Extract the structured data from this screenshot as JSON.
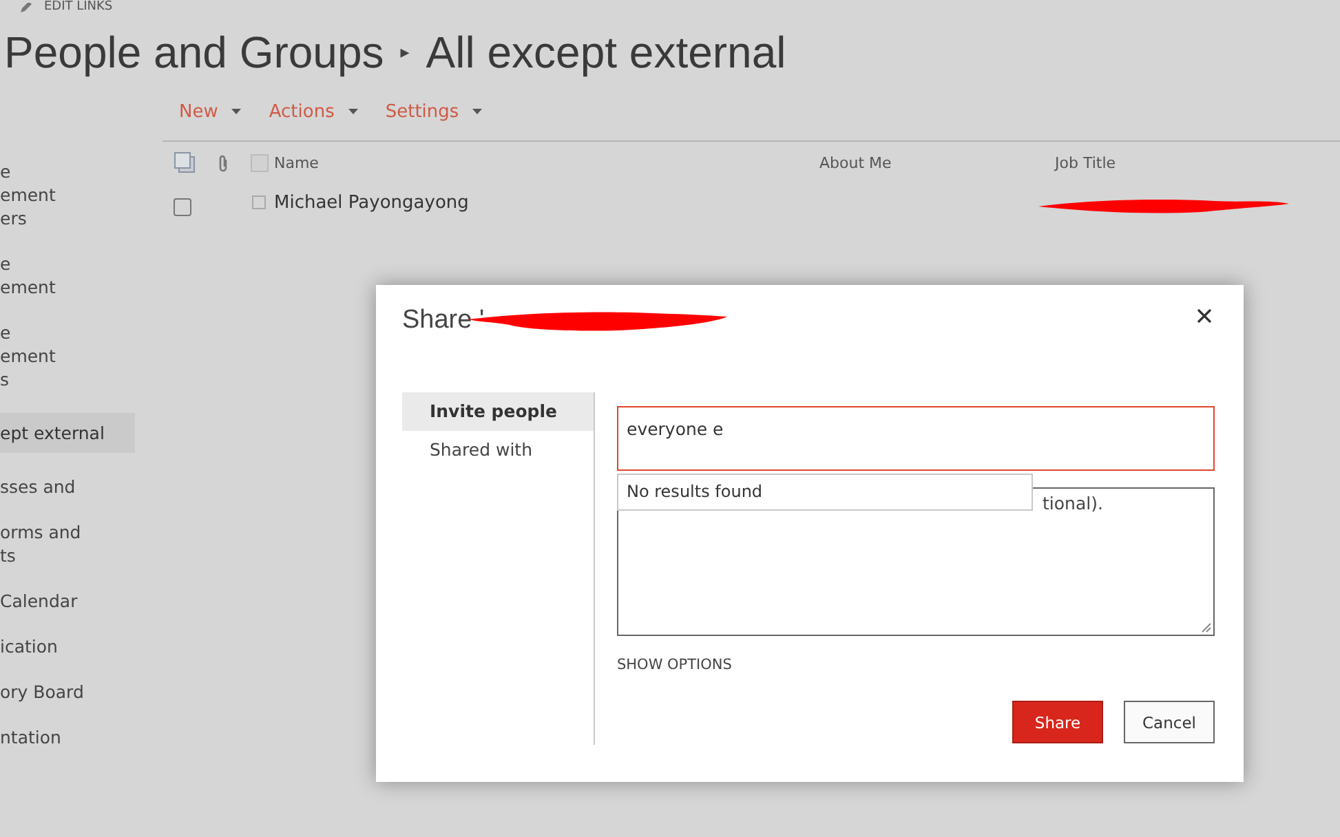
{
  "edit_links": "EDIT LINKS",
  "breadcrumb": {
    "parent": "People and Groups",
    "separator": "▸",
    "current": "All except external"
  },
  "sidebar": {
    "items": [
      {
        "lines": [
          "e",
          "ement",
          "ers"
        ],
        "selected": false
      },
      {
        "lines": [
          "e",
          "ement"
        ],
        "selected": false
      },
      {
        "lines": [
          "e",
          "ement",
          "s"
        ],
        "selected": false
      },
      {
        "lines": [
          "ept external"
        ],
        "selected": true
      },
      {
        "lines": [
          "sses and"
        ],
        "selected": false
      },
      {
        "lines": [
          "orms and",
          "ts"
        ],
        "selected": false
      },
      {
        "lines": [
          "Calendar"
        ],
        "selected": false
      },
      {
        "lines": [
          "ication"
        ],
        "selected": false
      },
      {
        "lines": [
          "ory Board"
        ],
        "selected": false
      },
      {
        "lines": [
          "ntation"
        ],
        "selected": false
      }
    ]
  },
  "commands": [
    {
      "label": "New"
    },
    {
      "label": "Actions"
    },
    {
      "label": "Settings"
    }
  ],
  "list": {
    "columns": [
      "Name",
      "About Me",
      "Job Title"
    ],
    "all_checked": false,
    "rows": [
      {
        "name": "Michael Payongayong",
        "checked": false,
        "item_checked": false
      }
    ]
  },
  "dialog": {
    "title": "Share '",
    "tabs": [
      {
        "label": "Invite people",
        "selected": true
      },
      {
        "label": "Shared with",
        "selected": false
      }
    ],
    "people_field": {
      "value": "everyone e"
    },
    "suggestions": {
      "message": "No results found"
    },
    "message_field": {
      "visible_text": "tional)."
    },
    "show_options": "SHOW OPTIONS",
    "buttons": [
      {
        "label": "Share",
        "kind": "primary"
      },
      {
        "label": "Cancel",
        "kind": "secondary"
      }
    ]
  }
}
